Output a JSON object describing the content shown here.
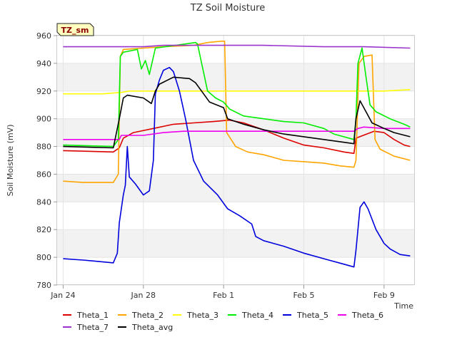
{
  "chart_data": {
    "type": "line",
    "title": "TZ Soil Moisture",
    "badge": "TZ_sm",
    "xlabel": "Time",
    "ylabel": "Soil Moisture (mV)",
    "ylim": [
      780,
      960
    ],
    "yticks": [
      780,
      800,
      820,
      840,
      860,
      880,
      900,
      920,
      940,
      960
    ],
    "xlim_days": [
      -0.3,
      17.5
    ],
    "xticks": [
      {
        "day": 0,
        "label": "Jan 24"
      },
      {
        "day": 4,
        "label": "Jan 28"
      },
      {
        "day": 8,
        "label": "Feb 1"
      },
      {
        "day": 12,
        "label": "Feb 5"
      },
      {
        "day": 16,
        "label": "Feb 9"
      }
    ],
    "grid": true,
    "legend_position": "bottom",
    "series": [
      {
        "name": "Theta_1",
        "color": "#dd0000",
        "points": [
          [
            0,
            877
          ],
          [
            2.5,
            876
          ],
          [
            2.8,
            879
          ],
          [
            3.0,
            886
          ],
          [
            3.5,
            890
          ],
          [
            4.5,
            893
          ],
          [
            5.5,
            896
          ],
          [
            6.5,
            897
          ],
          [
            7.5,
            898
          ],
          [
            8.3,
            899
          ],
          [
            9.0,
            897
          ],
          [
            10.0,
            892
          ],
          [
            11.0,
            886
          ],
          [
            12.0,
            881
          ],
          [
            13.0,
            879
          ],
          [
            14.0,
            876
          ],
          [
            14.5,
            875
          ],
          [
            14.6,
            886
          ],
          [
            15.5,
            891
          ],
          [
            16.0,
            890
          ],
          [
            16.5,
            885
          ],
          [
            17.0,
            881
          ],
          [
            17.3,
            880
          ]
        ]
      },
      {
        "name": "Theta_2",
        "color": "#ffa500",
        "points": [
          [
            0,
            855
          ],
          [
            1.0,
            854
          ],
          [
            2.5,
            854
          ],
          [
            2.75,
            860
          ],
          [
            2.85,
            945
          ],
          [
            3.0,
            950
          ],
          [
            4.0,
            951
          ],
          [
            5.0,
            952
          ],
          [
            6.5,
            953
          ],
          [
            7.2,
            955
          ],
          [
            7.9,
            956
          ],
          [
            8.05,
            956
          ],
          [
            8.15,
            890
          ],
          [
            8.6,
            880
          ],
          [
            9.2,
            876
          ],
          [
            10.0,
            874
          ],
          [
            11.0,
            870
          ],
          [
            12.0,
            869
          ],
          [
            13.0,
            868
          ],
          [
            13.8,
            866
          ],
          [
            14.5,
            865
          ],
          [
            14.6,
            870
          ],
          [
            14.75,
            940
          ],
          [
            15.0,
            945
          ],
          [
            15.4,
            946
          ],
          [
            15.55,
            885
          ],
          [
            15.8,
            878
          ],
          [
            16.5,
            873
          ],
          [
            17.3,
            870
          ]
        ]
      },
      {
        "name": "Theta_3",
        "color": "#ffff00",
        "points": [
          [
            0,
            918
          ],
          [
            2.0,
            918
          ],
          [
            2.9,
            919
          ],
          [
            3.3,
            920
          ],
          [
            5.0,
            920
          ],
          [
            8.0,
            920
          ],
          [
            11.0,
            920
          ],
          [
            14.0,
            920
          ],
          [
            16.0,
            920
          ],
          [
            17.3,
            921
          ]
        ]
      },
      {
        "name": "Theta_4",
        "color": "#00ee00",
        "points": [
          [
            0,
            881
          ],
          [
            2.5,
            880
          ],
          [
            2.75,
            885
          ],
          [
            2.85,
            945
          ],
          [
            3.0,
            948
          ],
          [
            3.7,
            950
          ],
          [
            3.9,
            936
          ],
          [
            4.1,
            942
          ],
          [
            4.3,
            932
          ],
          [
            4.6,
            951
          ],
          [
            6.6,
            955
          ],
          [
            6.7,
            954
          ],
          [
            7.2,
            920
          ],
          [
            7.6,
            915
          ],
          [
            8.0,
            912
          ],
          [
            8.3,
            907
          ],
          [
            9.0,
            902
          ],
          [
            10.0,
            900
          ],
          [
            11.0,
            898
          ],
          [
            12.0,
            897
          ],
          [
            13.0,
            893
          ],
          [
            13.5,
            889
          ],
          [
            14.5,
            885
          ],
          [
            14.6,
            900
          ],
          [
            14.7,
            940
          ],
          [
            14.9,
            951
          ],
          [
            15.1,
            930
          ],
          [
            15.3,
            910
          ],
          [
            15.6,
            905
          ],
          [
            16.3,
            900
          ],
          [
            17.0,
            896
          ],
          [
            17.3,
            894
          ]
        ]
      },
      {
        "name": "Theta_5",
        "color": "#0000dd",
        "points": [
          [
            0,
            799
          ],
          [
            1.0,
            798
          ],
          [
            2.5,
            796
          ],
          [
            2.7,
            803
          ],
          [
            2.8,
            825
          ],
          [
            3.0,
            845
          ],
          [
            3.1,
            852
          ],
          [
            3.2,
            880
          ],
          [
            3.3,
            858
          ],
          [
            3.6,
            853
          ],
          [
            4.0,
            845
          ],
          [
            4.3,
            848
          ],
          [
            4.5,
            870
          ],
          [
            4.6,
            918
          ],
          [
            4.8,
            928
          ],
          [
            5.0,
            935
          ],
          [
            5.3,
            937
          ],
          [
            5.5,
            934
          ],
          [
            5.8,
            920
          ],
          [
            6.1,
            900
          ],
          [
            6.5,
            870
          ],
          [
            7.0,
            855
          ],
          [
            7.7,
            845
          ],
          [
            8.2,
            835
          ],
          [
            8.8,
            830
          ],
          [
            9.4,
            824
          ],
          [
            9.6,
            815
          ],
          [
            10.0,
            812
          ],
          [
            11.0,
            808
          ],
          [
            12.0,
            803
          ],
          [
            13.0,
            799
          ],
          [
            14.0,
            795
          ],
          [
            14.5,
            793
          ],
          [
            14.6,
            805
          ],
          [
            14.8,
            836
          ],
          [
            15.0,
            840
          ],
          [
            15.2,
            835
          ],
          [
            15.6,
            820
          ],
          [
            16.0,
            810
          ],
          [
            16.3,
            806
          ],
          [
            16.8,
            802
          ],
          [
            17.3,
            801
          ]
        ]
      },
      {
        "name": "Theta_6",
        "color": "#ee00ee",
        "points": [
          [
            0,
            885
          ],
          [
            2.8,
            885
          ],
          [
            2.9,
            888
          ],
          [
            4.0,
            888
          ],
          [
            5.0,
            890
          ],
          [
            6.0,
            891
          ],
          [
            8.0,
            891
          ],
          [
            11.0,
            891
          ],
          [
            13.0,
            891
          ],
          [
            14.5,
            891
          ],
          [
            14.7,
            893
          ],
          [
            15.0,
            894
          ],
          [
            16.0,
            893
          ],
          [
            17.3,
            893
          ]
        ]
      },
      {
        "name": "Theta_7",
        "color": "#9933cc",
        "points": [
          [
            0,
            952
          ],
          [
            2.5,
            952
          ],
          [
            4.0,
            952
          ],
          [
            5.0,
            953
          ],
          [
            7.0,
            953
          ],
          [
            10.0,
            953
          ],
          [
            13.0,
            952
          ],
          [
            15.0,
            952
          ],
          [
            17.3,
            951
          ]
        ]
      },
      {
        "name": "Theta_avg",
        "color": "#000000",
        "points": [
          [
            0,
            880
          ],
          [
            2.5,
            879
          ],
          [
            2.8,
            900
          ],
          [
            3.0,
            915
          ],
          [
            3.2,
            917
          ],
          [
            4.0,
            915
          ],
          [
            4.4,
            911
          ],
          [
            4.6,
            920
          ],
          [
            4.8,
            925
          ],
          [
            5.5,
            930
          ],
          [
            6.3,
            929
          ],
          [
            6.6,
            926
          ],
          [
            7.0,
            918
          ],
          [
            7.3,
            912
          ],
          [
            8.0,
            908
          ],
          [
            8.2,
            900
          ],
          [
            9.0,
            896
          ],
          [
            10.0,
            892
          ],
          [
            11.0,
            889
          ],
          [
            12.0,
            887
          ],
          [
            13.0,
            885
          ],
          [
            14.0,
            883
          ],
          [
            14.5,
            882
          ],
          [
            14.6,
            900
          ],
          [
            14.8,
            913
          ],
          [
            15.1,
            905
          ],
          [
            15.4,
            897
          ],
          [
            16.0,
            893
          ],
          [
            16.5,
            890
          ],
          [
            17.3,
            887
          ]
        ]
      }
    ]
  }
}
